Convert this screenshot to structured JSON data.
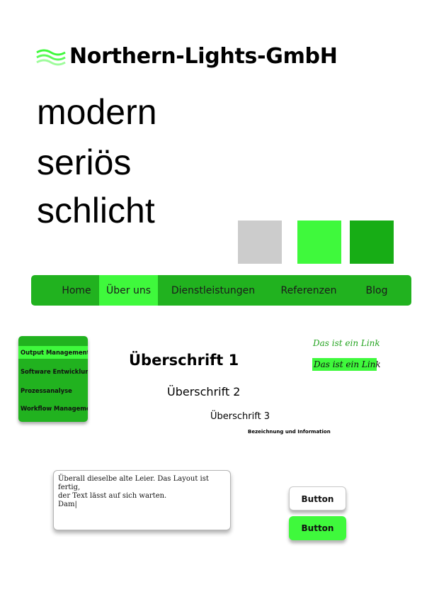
{
  "brand": {
    "name": "Northern-Lights-GmbH",
    "icon": "waves-icon"
  },
  "tagline": [
    "modern",
    "seriös",
    "schlicht"
  ],
  "colors": {
    "gray": "#cccccc",
    "light_green": "#3ff93c",
    "dark_green": "#17ad15",
    "nav_bg": "#21b21f"
  },
  "nav": {
    "items": [
      "Home",
      "Über uns",
      "Dienstleistungen",
      "Referenzen",
      "Blog"
    ],
    "active": "Über uns"
  },
  "sidemenu": {
    "items": [
      "Output Management",
      "Software Entwicklung",
      "Prozessanalyse",
      "Workflow Management"
    ],
    "active": "Output Management"
  },
  "typography": {
    "h1": "Überschrift 1",
    "h2": "Überschrift 2",
    "h3": "Überschrift 3",
    "caption": "Bezeichnung und Information"
  },
  "links": {
    "normal": "Das ist ein Link",
    "hover": "Das ist ein Link"
  },
  "textarea": {
    "value": "Überall dieselbe alte Leier. Das Layout ist fertig,\nder Text lässt auf sich warten.\nDam|"
  },
  "buttons": {
    "default": "Button",
    "active": "Button"
  }
}
